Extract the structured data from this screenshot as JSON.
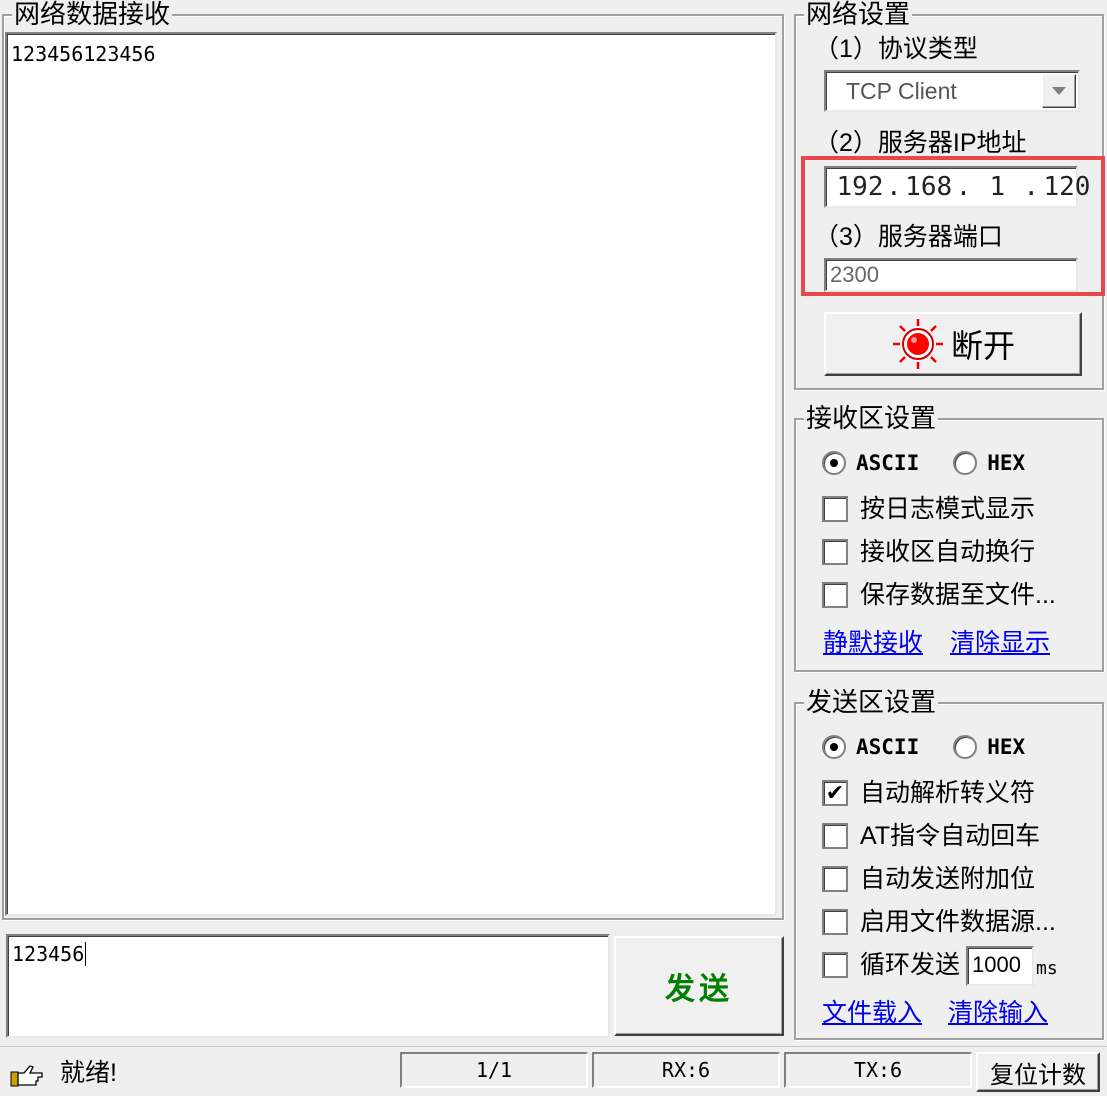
{
  "receive_panel": {
    "title": "网络数据接收",
    "content": "123456123456"
  },
  "send_input": {
    "value": "123456"
  },
  "send_button": {
    "label": "发送",
    "color": "#007f00"
  },
  "network_settings": {
    "title": "网络设置",
    "protocol_label": "（1）协议类型",
    "protocol_value": "TCP Client",
    "ip_label": "（2）服务器IP地址",
    "ip_octets": [
      "192",
      "168",
      "1",
      "120"
    ],
    "port_label": "（3）服务器端口",
    "port_value": "2300",
    "connect_button": "断开",
    "highlight_color": "#e8474c"
  },
  "receive_settings": {
    "title": "接收区设置",
    "radio_ascii": "ASCII",
    "radio_hex": "HEX",
    "options": [
      "按日志模式显示",
      "接收区自动换行",
      "保存数据至文件..."
    ],
    "link_pause": "静默接收",
    "link_clear": "清除显示"
  },
  "send_settings": {
    "title": "发送区设置",
    "radio_ascii": "ASCII",
    "radio_hex": "HEX",
    "options": [
      "自动解析转义符",
      "AT指令自动回车",
      "自动发送附加位",
      "启用文件数据源..."
    ],
    "loop_label": "循环发送",
    "loop_interval": "1000",
    "loop_unit": "ms",
    "link_load": "文件载入",
    "link_clear": "清除输入"
  },
  "status_bar": {
    "status": "就绪!",
    "page": "1/1",
    "rx": "RX:6",
    "tx": "TX:6",
    "reset_button": "复位计数"
  }
}
